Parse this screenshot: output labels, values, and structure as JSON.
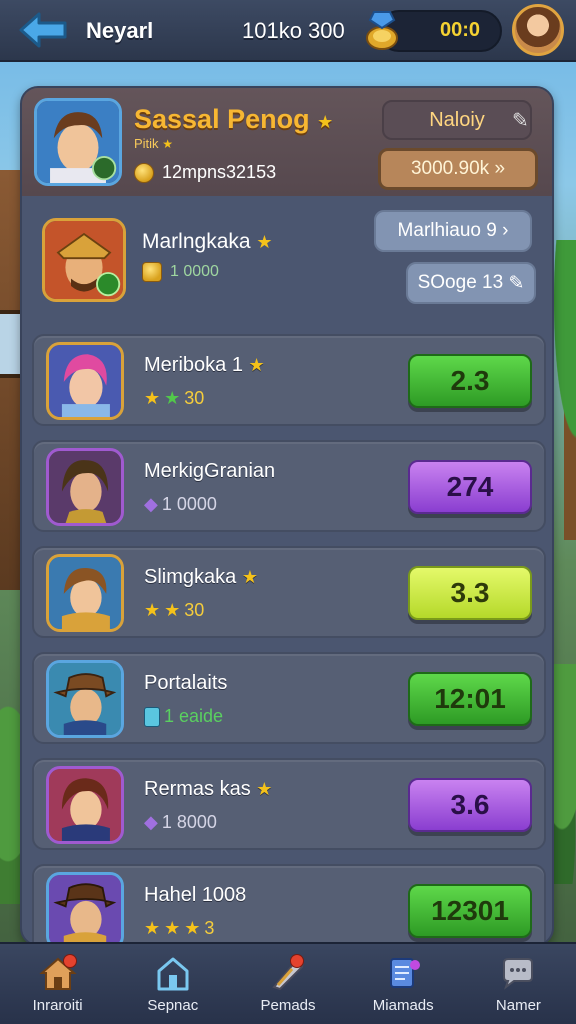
{
  "header": {
    "title": "Neyarl",
    "score": "101ko 300",
    "currency_value": "00:0"
  },
  "profile": {
    "name": "Sassal Penog",
    "subtitle": "Pitik",
    "coins": "12mpns32153",
    "button_top": "Naloiy",
    "button_bottom": "3000.90k"
  },
  "featured": {
    "name": "Marlngkaka",
    "coins": "1 0000",
    "button_top": "Marlhiauo 9",
    "button_bottom": "SOoge 13"
  },
  "rows": [
    {
      "name": "Meriboka 1",
      "sub": "30",
      "value": "2.3",
      "style": "green",
      "icon": "star-icon"
    },
    {
      "name": "MerkigGranian",
      "sub": "1 0000",
      "value": "274",
      "style": "purple",
      "icon": "gem-icon"
    },
    {
      "name": "Slimgkaka",
      "sub": "30",
      "value": "3.3",
      "style": "lime",
      "icon": "star-icon"
    },
    {
      "name": "Portalaits",
      "sub": "1 eaide",
      "value": "12:01",
      "style": "green",
      "icon": "potion-icon"
    },
    {
      "name": "Rermas kas",
      "sub": "1 8000",
      "value": "3.6",
      "style": "purple",
      "icon": "gem-icon"
    },
    {
      "name": "Hahel 1008",
      "sub": "3",
      "value": "12301",
      "style": "green",
      "icon": "star-icon"
    }
  ],
  "nav": [
    {
      "label": "Inraroiti",
      "icon": "home-icon"
    },
    {
      "label": "Sepnac",
      "icon": "house-icon"
    },
    {
      "label": "Pemads",
      "icon": "quill-icon"
    },
    {
      "label": "Miamads",
      "icon": "scroll-icon"
    },
    {
      "label": "Namer",
      "icon": "chat-icon"
    }
  ],
  "colors": {
    "accent_gold": "#f7b733",
    "value_green": "#2e9b25",
    "value_purple": "#8a3ed0",
    "value_lime": "#b5d92a"
  }
}
